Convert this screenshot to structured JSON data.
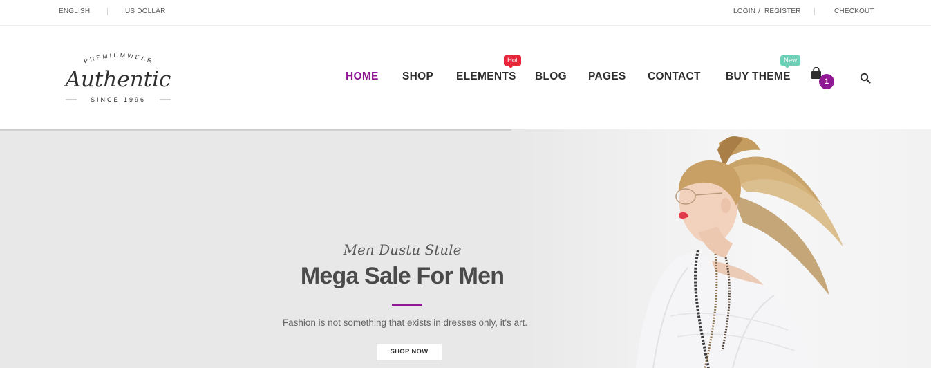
{
  "topbar": {
    "language": "ENGLISH",
    "currency": "US DOLLAR",
    "login": "LOGIN",
    "separator": "/",
    "register": "REGISTER",
    "checkout": "CHECKOUT"
  },
  "logo": {
    "top_text": "PREMIUMWEAR",
    "name": "Authentic",
    "bottom_text": "SINCE 1996"
  },
  "nav": {
    "items": [
      {
        "label": "HOME",
        "active": true
      },
      {
        "label": "SHOP"
      },
      {
        "label": "ELEMENTS",
        "badge": "Hot"
      },
      {
        "label": "BLOG"
      },
      {
        "label": "PAGES"
      },
      {
        "label": "CONTACT"
      },
      {
        "label": "BUY THEME",
        "badge": "New"
      }
    ]
  },
  "cart": {
    "count": "1",
    "icon": "shopping-bag-icon"
  },
  "search": {
    "icon": "search-icon"
  },
  "hero": {
    "script_title": "Men Dustu Stule",
    "title": "Mega Sale For Men",
    "text": "Fashion is not something that exists in dresses only, it's art.",
    "button": "SHOP NOW"
  },
  "colors": {
    "accent": "#8f1894",
    "badge_hot": "#e7273a",
    "badge_new": "#6fd0b8",
    "hero_bg": "#e8e8e8"
  }
}
